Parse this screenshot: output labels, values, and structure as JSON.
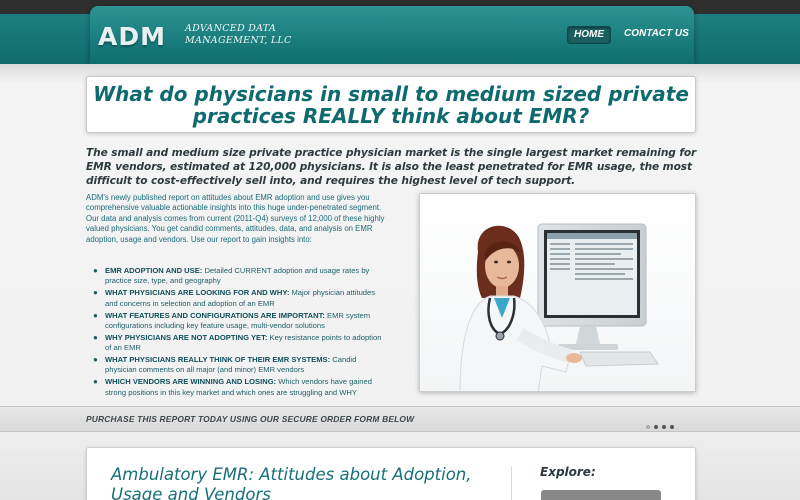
{
  "header": {
    "logo": "ADM",
    "company_line1": "ADVANCED DATA",
    "company_line2": "MANAGEMENT, LLC",
    "nav": {
      "home": "HOME",
      "contact": "CONTACT US"
    }
  },
  "hero": {
    "title_line1": "What do physicians in small to medium sized private",
    "title_line2": "practices REALLY think about EMR?"
  },
  "intro": "The small and medium size private practice physician market is the single largest market remaining for EMR vendors, estimated at 120,000 physicians. It is also the least penetrated for EMR usage, the most difficult to cost-effectively sell into, and requires the highest level of tech support.",
  "body_text": "ADM's newly published report on attitudes about EMR adoption and use gives you comprehensive valuable actionable insights into this huge under-penetrated segment. Our data and analysis comes from current (2011-Q4) surveys of 12,000 of these highly valued physicians. You get candid comments, attitudes, data, and analysis on EMR adoption, usage and vendors. Use our report to gain insights into:",
  "bullets": [
    {
      "head": "EMR ADOPTION AND USE:",
      "text": " Detailed CURRENT adoption and usage rates by practice size, type, and geography"
    },
    {
      "head": "WHAT PHYSICIANS ARE LOOKING FOR AND WHY:",
      "text": " Major physician attitudes and concerns in selection and adoption of an EMR"
    },
    {
      "head": "WHAT FEATURES AND CONFIGURATIONS ARE IMPORTANT:",
      "text": " EMR system configurations including key feature usage, multi-vendor solutions"
    },
    {
      "head": "WHY PHYSICIANS ARE NOT ADOPTING YET:",
      "text": " Key resistance points to adoption of an EMR"
    },
    {
      "head": "WHAT PHYSICIANS REALLY THINK OF THEIR EMR SYSTEMS:",
      "text": " Candid physician comments on all major (and minor) EMR vendors"
    },
    {
      "head": "WHICH VENDORS ARE WINNING AND LOSING:",
      "text": " Which vendors have gained strong positions in this key market and which ones are struggling and WHY"
    }
  ],
  "purchase_strip": "PURCHASE THIS REPORT TODAY USING OUR SECURE ORDER FORM BELOW",
  "bottom": {
    "title": "Ambulatory EMR: Attitudes about Adoption, Usage and Vendors",
    "explore": "Explore:"
  },
  "colors": {
    "brand_teal": "#0e6a6f",
    "header_teal": "#1f7f80"
  }
}
